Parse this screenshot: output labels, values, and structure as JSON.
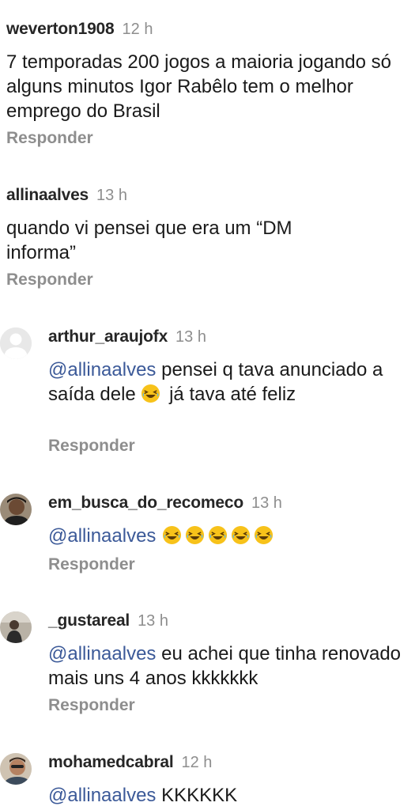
{
  "comments": [
    {
      "username": "weverton1908",
      "time": "12 h",
      "text": "7 temporadas 200 jogos a maioria jogando só alguns minutos Igor Rabêlo tem o melhor emprego do Brasil",
      "reply": "Responder"
    },
    {
      "username": "allinaalves",
      "time": "13 h",
      "text": "quando vi pensei que era um “DM informa”",
      "reply": "Responder"
    },
    {
      "username": "arthur_araujofx",
      "time": "13 h",
      "mention": "@allinaalves",
      "text_a": " pensei q tava anunciado a saída dele ",
      "text_b": " já tava até feliz",
      "reply": "Responder"
    },
    {
      "username": "em_busca_do_recomeco",
      "time": "13 h",
      "mention": "@allinaalves",
      "reply": "Responder"
    },
    {
      "username": "_gustareal",
      "time": "13 h",
      "mention": "@allinaalves",
      "text": " eu achei que tinha renovado mais uns 4 anos kkkkkkk",
      "reply": "Responder"
    },
    {
      "username": "mohamedcabral",
      "time": "12 h",
      "mention": "@allinaalves",
      "text": " KKKKKK"
    }
  ]
}
